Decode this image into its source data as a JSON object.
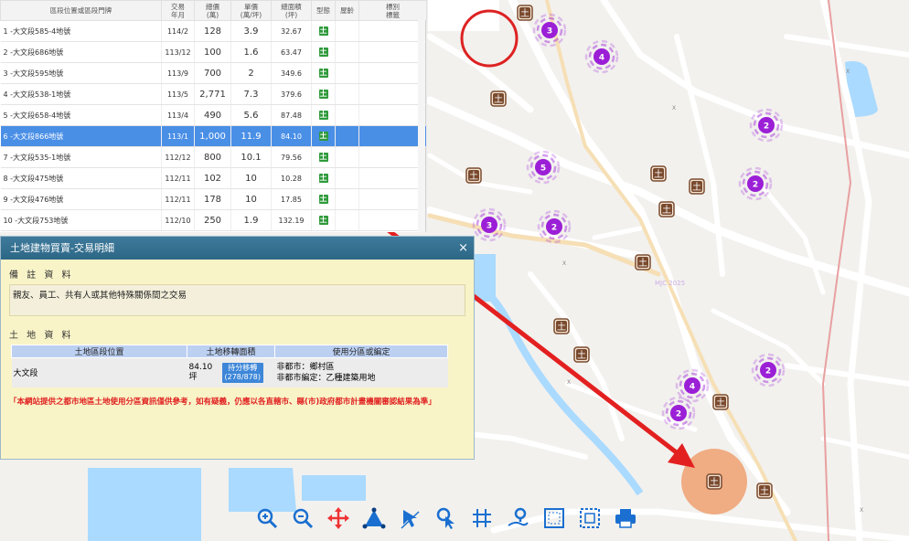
{
  "table": {
    "headers": [
      "區段位置或區段門牌",
      "交易\n年月",
      "總價\n(萬)",
      "單價\n(萬/坪)",
      "總面積\n(坪)",
      "型態",
      "屋齡",
      "標別\n標籤"
    ],
    "rows": [
      {
        "loc": "1 -大文段585-4地號",
        "date": "114/2",
        "total": "128",
        "unit": "3.9",
        "area": "32.67",
        "type": "土"
      },
      {
        "loc": "2 -大文段686地號",
        "date": "113/12",
        "total": "100",
        "unit": "1.6",
        "area": "63.47",
        "type": "土"
      },
      {
        "loc": "3 -大文段595地號",
        "date": "113/9",
        "total": "700",
        "unit": "2",
        "area": "349.6",
        "type": "土"
      },
      {
        "loc": "4 -大文段538-1地號",
        "date": "113/5",
        "total": "2,771",
        "unit": "7.3",
        "area": "379.6",
        "type": "土"
      },
      {
        "loc": "5 -大文段658-4地號",
        "date": "113/4",
        "total": "490",
        "unit": "5.6",
        "area": "87.48",
        "type": "土"
      },
      {
        "loc": "6 -大文段866地號",
        "date": "113/1",
        "total": "1,000",
        "unit": "11.9",
        "area": "84.10",
        "type": "土"
      },
      {
        "loc": "7 -大文段535-1地號",
        "date": "112/12",
        "total": "800",
        "unit": "10.1",
        "area": "79.56",
        "type": "土"
      },
      {
        "loc": "8 -大文段475地號",
        "date": "112/11",
        "total": "102",
        "unit": "10",
        "area": "10.28",
        "type": "土"
      },
      {
        "loc": "9 -大文段476地號",
        "date": "112/11",
        "total": "178",
        "unit": "10",
        "area": "17.85",
        "type": "土"
      },
      {
        "loc": "10 -大文段753地號",
        "date": "112/10",
        "total": "250",
        "unit": "1.9",
        "area": "132.19",
        "type": "土"
      }
    ],
    "selected_index": 5
  },
  "dialog": {
    "title": "土地建物買賣-交易明細",
    "close": "×",
    "remarks_title": "備 註 資 料",
    "remarks_text": "親友、員工、共有人或其他特殊關係間之交易",
    "land_title": "土 地 資 料",
    "land_headers": [
      "土地區段位置",
      "土地移轉面積",
      "使用分區或編定"
    ],
    "land_row": {
      "location": "大文段",
      "area_value": "84.10",
      "area_unit": "坪",
      "badge_line1": "持分移轉",
      "badge_line2": "(278/878)",
      "zoning_line1": "非都市：鄉村區",
      "zoning_line2": "非都市編定：乙種建築用地"
    },
    "disclaimer": "「本網站提供之都市地區土地使用分區資訊僅供參考，如有疑義，仍應以各直轄市、縣(市)政府都市計畫機關審認結果為準」"
  },
  "map": {
    "clusters": [
      "3",
      "4",
      "2",
      "5",
      "2",
      "3",
      "2",
      "2",
      "4",
      "2"
    ],
    "parcel_marker": "土",
    "road_labels": [
      "X",
      "X",
      "X",
      "X",
      "X"
    ],
    "watermark": "MJC 2025"
  },
  "toolbar": {
    "tools": [
      "zoom-in-icon",
      "zoom-out-icon",
      "pan-icon",
      "measure-area-icon",
      "select-icon",
      "info-select-icon",
      "parcel-grid-icon",
      "locate-pin-icon",
      "frame-select-icon",
      "clear-select-icon",
      "print-icon"
    ]
  },
  "colors": {
    "selected_row": "#4a8fe6",
    "cluster": "#9b1fd6",
    "parcel_marker": "#7a4a2e",
    "annotation_arrow": "#e62020",
    "dialog_header": "#3a7497",
    "dialog_body": "#f9f4c8"
  }
}
